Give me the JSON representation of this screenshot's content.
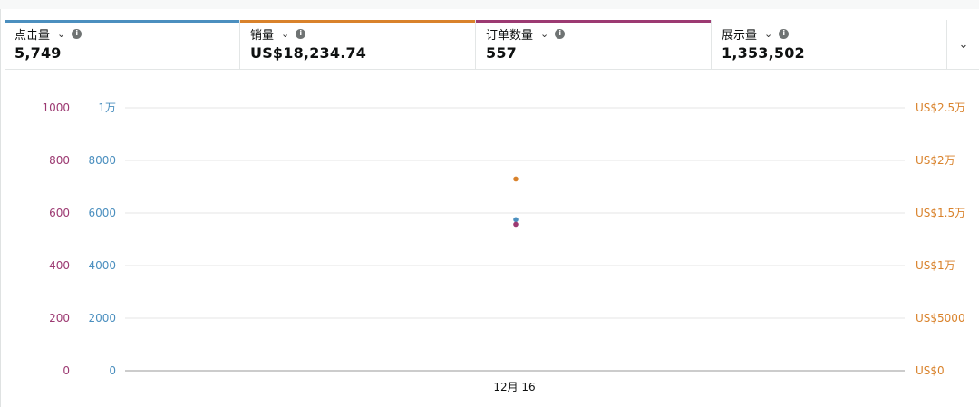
{
  "metrics": [
    {
      "label": "点击量",
      "value": "5,749",
      "color": "#4b8fbf"
    },
    {
      "label": "销量",
      "value": "US$18,234.74",
      "color": "#d9822b"
    },
    {
      "label": "订单数量",
      "value": "557",
      "color": "#9c3a72"
    },
    {
      "label": "展示量",
      "value": "1,353,502",
      "color": "#ffffff"
    }
  ],
  "icons": {
    "chevron": "chevron-down-icon",
    "info": "info-icon",
    "expand": "chevron-down-icon"
  },
  "chart_data": {
    "type": "scatter",
    "x": [
      "12月 16"
    ],
    "series": [
      {
        "values": [
          5749
        ],
        "axis": "left-inner",
        "color": "#4b8fbf"
      },
      {
        "values": [
          18234.74
        ],
        "axis": "right",
        "color": "#d9822b"
      },
      {
        "values": [
          557
        ],
        "axis": "left-outer",
        "color": "#9c3a72"
      }
    ],
    "axes": {
      "left_outer": {
        "ticks": [
          "0",
          "200",
          "400",
          "600",
          "800",
          "1000"
        ],
        "range": [
          0,
          1000
        ],
        "color": "#9c3a72"
      },
      "left_inner": {
        "ticks": [
          "0",
          "2000",
          "4000",
          "6000",
          "8000",
          "1万"
        ],
        "range": [
          0,
          10000
        ],
        "color": "#4b8fbf"
      },
      "right": {
        "ticks": [
          "US$0",
          "US$5000",
          "US$1万",
          "US$1.5万",
          "US$2万",
          "US$2.5万"
        ],
        "range": [
          0,
          25000
        ],
        "color": "#d9822b"
      }
    },
    "grid": true
  }
}
